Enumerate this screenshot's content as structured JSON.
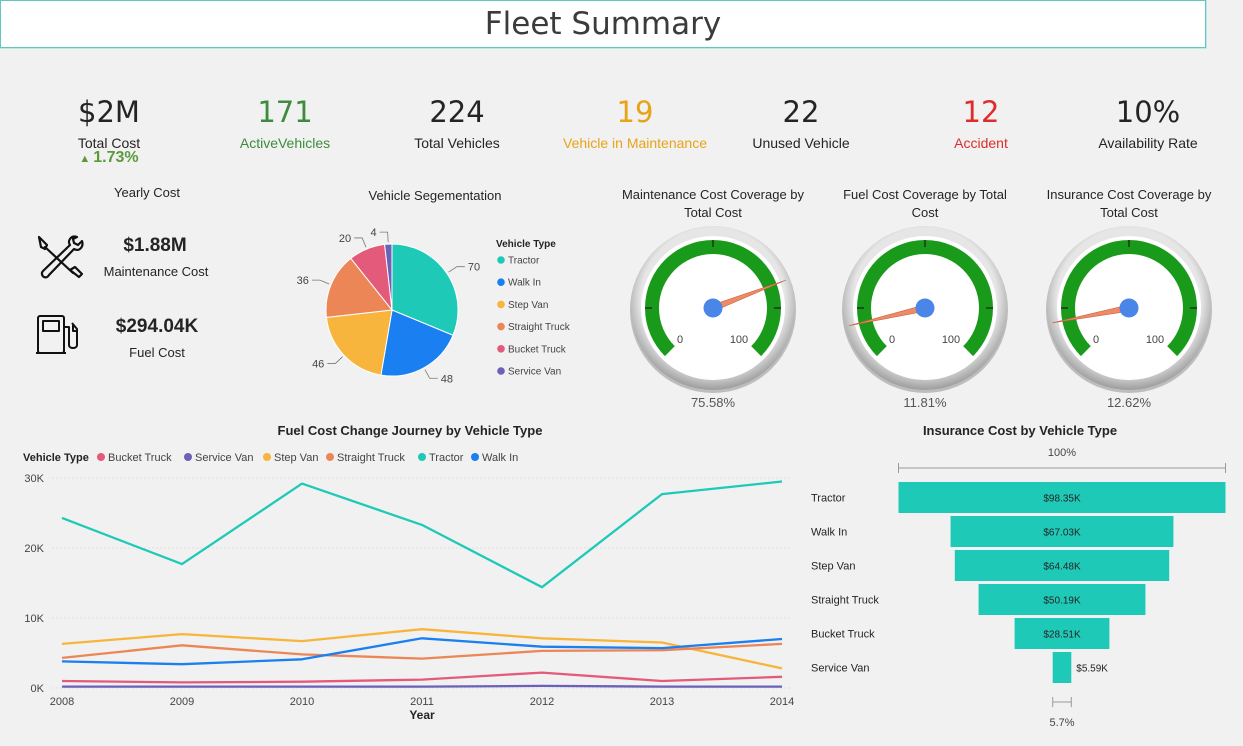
{
  "title": "Fleet Summary",
  "kpis": [
    {
      "value": "$2M",
      "label": "Total Cost",
      "change": "1.73%",
      "color": "#252423",
      "labelColor": "#252423"
    },
    {
      "value": "171",
      "label": "ActiveVehicles",
      "color": "#3d8b3d",
      "labelColor": "#3d8b3d"
    },
    {
      "value": "224",
      "label": "Total Vehicles",
      "color": "#252423",
      "labelColor": "#252423"
    },
    {
      "value": "19",
      "label": "Vehicle in Maintenance",
      "color": "#e8a317",
      "labelColor": "#e8a317"
    },
    {
      "value": "22",
      "label": "Unused Vehicle",
      "color": "#252423",
      "labelColor": "#252423"
    },
    {
      "value": "12",
      "label": "Accident",
      "color": "#e02b2b",
      "labelColor": "#e02b2b"
    },
    {
      "value": "10%",
      "label": "Availability Rate",
      "color": "#252423",
      "labelColor": "#252423"
    }
  ],
  "yearly_cost": {
    "title": "Yearly Cost",
    "maintenance_value": "$1.88M",
    "maintenance_label": "Maintenance Cost",
    "fuel_value": "$294.04K",
    "fuel_label": "Fuel Cost"
  },
  "gauges": [
    {
      "title_l1": "Maintenance Cost Coverage by",
      "title_l2": "Total Cost",
      "min": "0",
      "max": "100",
      "value": 75.58,
      "label": "75.58%"
    },
    {
      "title_l1": "Fuel Cost Coverage by Total",
      "title_l2": "Cost",
      "min": "0",
      "max": "100",
      "value": 11.81,
      "label": "11.81%"
    },
    {
      "title_l1": "Insurance Cost Coverage by",
      "title_l2": "Total Cost",
      "min": "0",
      "max": "100",
      "value": 12.62,
      "label": "12.62%"
    }
  ],
  "chart_data": [
    {
      "type": "pie",
      "title": "Vehicle Segementation",
      "legend_title": "Vehicle Type",
      "legend_position": "right",
      "categories": [
        "Tractor",
        "Walk In",
        "Step Van",
        "Straight Truck",
        "Bucket Truck",
        "Service Van"
      ],
      "values": [
        70,
        48,
        46,
        36,
        20,
        4
      ],
      "colors": [
        "#1ec9b7",
        "#1a7ff0",
        "#f7b53d",
        "#ec8656",
        "#e45a7a",
        "#6b61b8"
      ]
    },
    {
      "type": "line",
      "title": "Fuel Cost Change Journey by Vehicle Type",
      "legend_title": "Vehicle Type",
      "xlabel": "Year",
      "ylabel": "",
      "x": [
        2008,
        2009,
        2010,
        2011,
        2012,
        2013,
        2014
      ],
      "ylim": [
        0,
        30000
      ],
      "yticks": [
        "0K",
        "10K",
        "20K",
        "30K"
      ],
      "grid": true,
      "series": [
        {
          "name": "Bucket Truck",
          "color": "#e45a7a",
          "values": [
            1000,
            800,
            900,
            1200,
            2200,
            1000,
            1600
          ]
        },
        {
          "name": "Service Van",
          "color": "#6b61b8",
          "values": [
            200,
            200,
            200,
            200,
            300,
            200,
            200
          ]
        },
        {
          "name": "Step Van",
          "color": "#f7b53d",
          "values": [
            6300,
            7700,
            6700,
            8400,
            7100,
            6500,
            2800
          ]
        },
        {
          "name": "Straight Truck",
          "color": "#ec8656",
          "values": [
            4300,
            6100,
            4800,
            4200,
            5300,
            5400,
            6300
          ]
        },
        {
          "name": "Tractor",
          "color": "#1ec9b7",
          "values": [
            24300,
            17700,
            29200,
            23300,
            14400,
            27700,
            29500
          ]
        },
        {
          "name": "Walk In",
          "color": "#1a7ff0",
          "values": [
            3800,
            3400,
            4100,
            7100,
            5900,
            5700,
            7000
          ]
        }
      ]
    },
    {
      "type": "bar",
      "subtype": "funnel",
      "title": "Insurance Cost by Vehicle Type",
      "top_label": "100%",
      "bottom_label": "5.7%",
      "color": "#1ec9b7",
      "categories": [
        "Tractor",
        "Walk In",
        "Step Van",
        "Straight Truck",
        "Bucket Truck",
        "Service Van"
      ],
      "values": [
        98350,
        67030,
        64480,
        50190,
        28510,
        5590
      ],
      "labels": [
        "$98.35K",
        "$67.03K",
        "$64.48K",
        "$50.19K",
        "$28.51K",
        "$5.59K"
      ]
    }
  ]
}
